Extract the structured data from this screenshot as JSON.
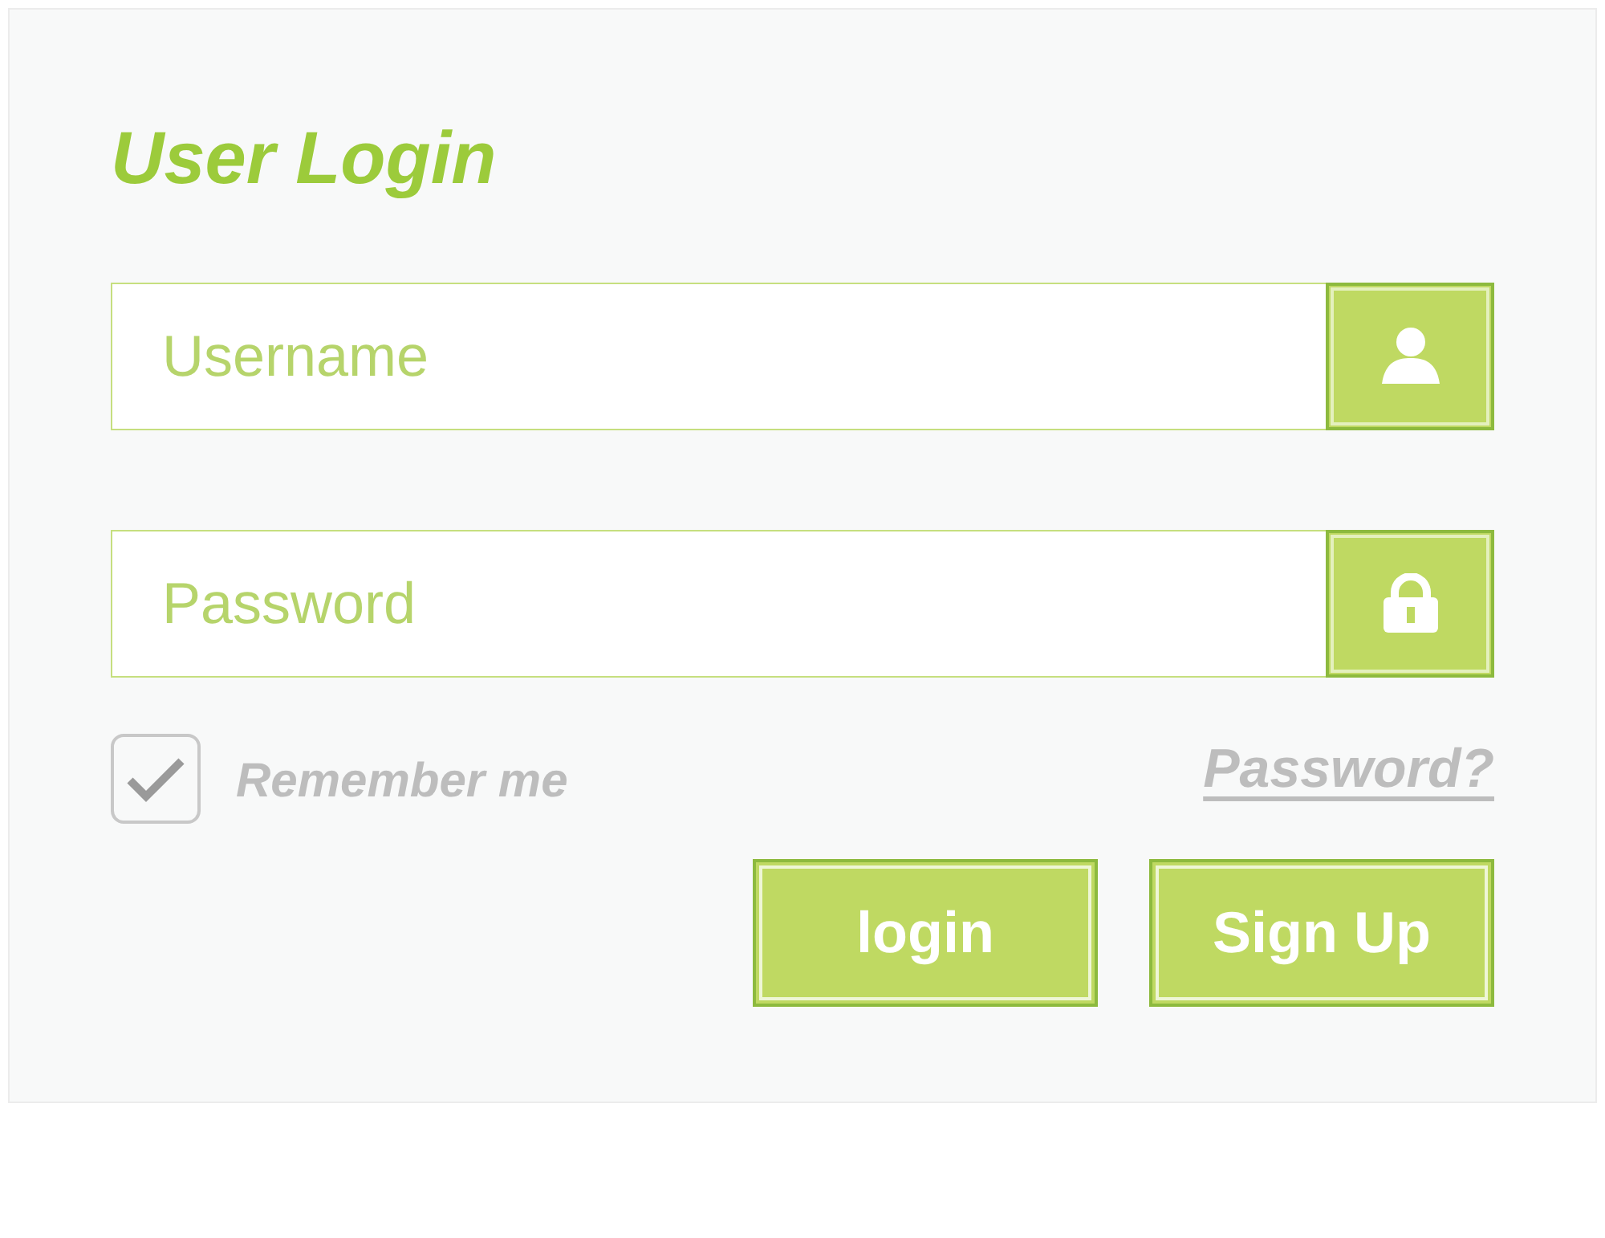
{
  "title": "User Login",
  "fields": [
    {
      "kind": "text",
      "placeholder": "Username"
    },
    {
      "kind": "password",
      "placeholder": "Password"
    }
  ],
  "remember": {
    "label": "Remember me",
    "checked": true
  },
  "forgot_link": "Password?",
  "buttons": [
    "login",
    "Sign Up"
  ]
}
